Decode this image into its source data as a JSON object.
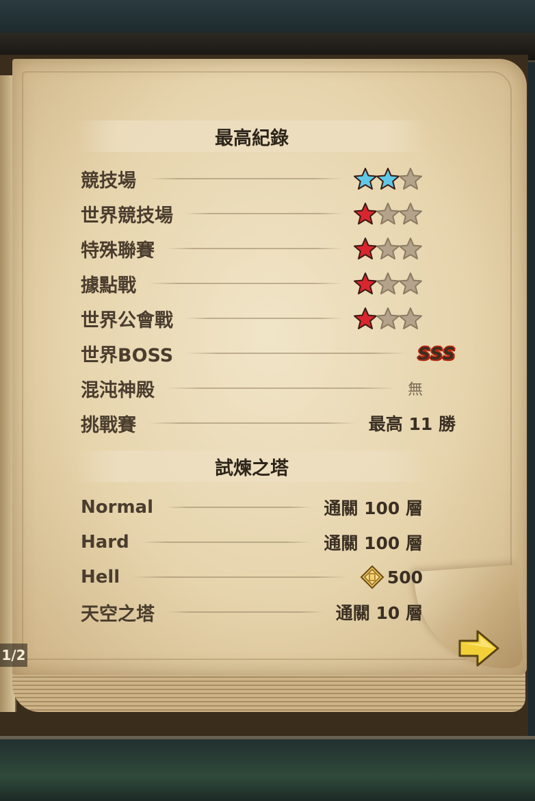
{
  "page_indicator": "1/2",
  "colors": {
    "star_cyan": "#5ec8e6",
    "star_red": "#d8262f",
    "star_empty": "#b3a38a",
    "arrow": "#f3d038"
  },
  "records": {
    "title": "最高紀錄",
    "rows": [
      {
        "label": "競技場",
        "stars_filled": 2,
        "star_color": "cyan",
        "stars_total": 3
      },
      {
        "label": "世界競技場",
        "stars_filled": 1,
        "star_color": "red",
        "stars_total": 3
      },
      {
        "label": "特殊聯賽",
        "stars_filled": 1,
        "star_color": "red",
        "stars_total": 3
      },
      {
        "label": "據點戰",
        "stars_filled": 1,
        "star_color": "red",
        "stars_total": 3
      },
      {
        "label": "世界公會戰",
        "stars_filled": 1,
        "star_color": "red",
        "stars_total": 3
      },
      {
        "label": "世界BOSS",
        "value": "SSS"
      },
      {
        "label": "混沌神殿",
        "value": "無"
      },
      {
        "label": "挑戰賽",
        "value": "最高 11 勝"
      }
    ]
  },
  "tower": {
    "title": "試煉之塔",
    "rows": [
      {
        "label": "Normal",
        "value": "通關 100 層"
      },
      {
        "label": "Hard",
        "value": "通關 100 層"
      },
      {
        "label": "Hell",
        "value": "500",
        "icon": "medal-icon"
      },
      {
        "label": "天空之塔",
        "value": "通關 10 層"
      }
    ]
  }
}
